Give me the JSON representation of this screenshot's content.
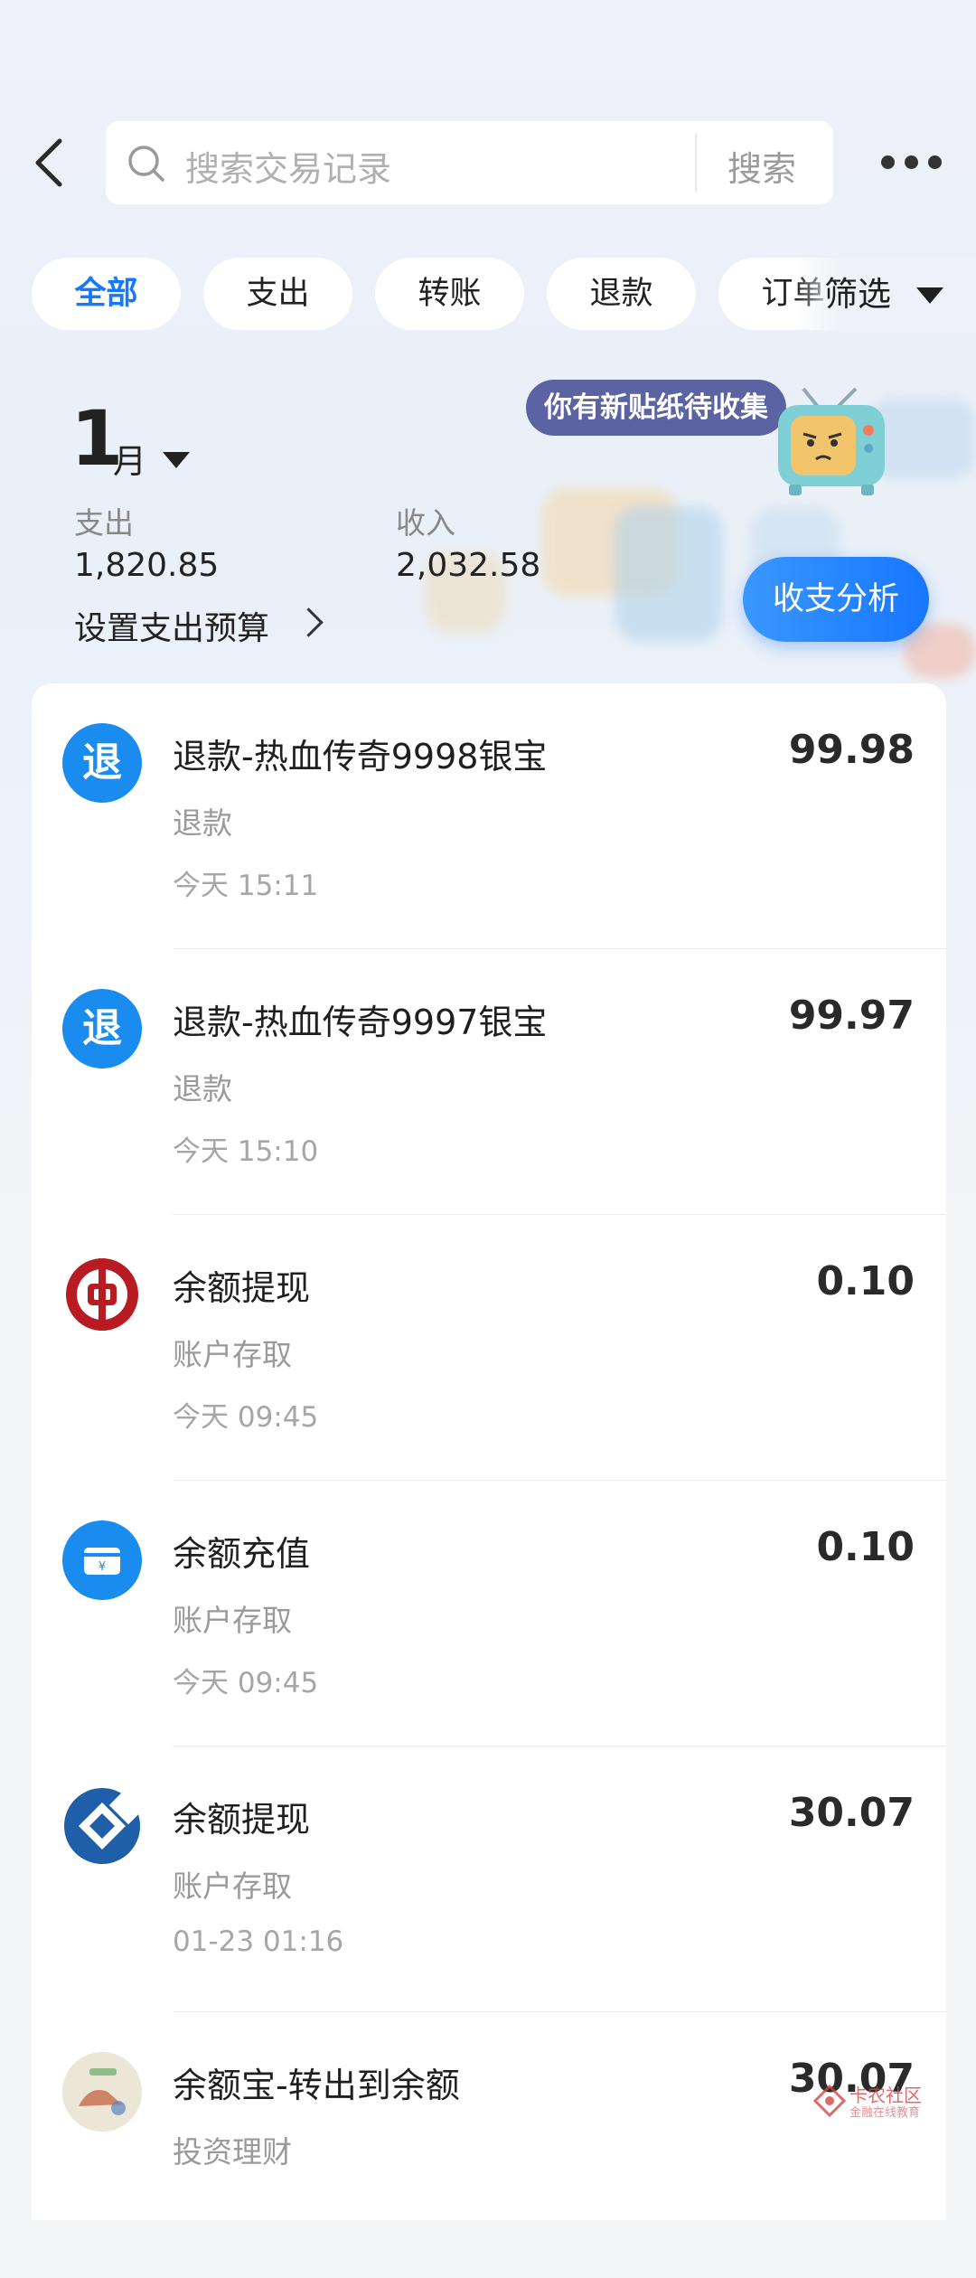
{
  "search": {
    "placeholder": "搜索交易记录",
    "button_label": "搜索"
  },
  "filters": {
    "chips": [
      {
        "label": "全部",
        "active": true
      },
      {
        "label": "支出",
        "active": false
      },
      {
        "label": "转账",
        "active": false
      },
      {
        "label": "退款",
        "active": false
      },
      {
        "label": "订单",
        "active": false
      }
    ],
    "filter_label": "筛选"
  },
  "summary": {
    "month_number": "1",
    "month_unit": "月",
    "expense_label": "支出",
    "expense_value": "1,820.85",
    "income_label": "收入",
    "income_value": "2,032.58",
    "budget_label": "设置支出预算",
    "sticker_tip": "你有新贴纸待收集",
    "analysis_button": "收支分析"
  },
  "transactions": [
    {
      "icon": "refund-icon",
      "icon_text": "退",
      "title": "退款-热血传奇9998银宝",
      "category": "退款",
      "time": "今天 15:11",
      "amount": "99.98"
    },
    {
      "icon": "refund-icon",
      "icon_text": "退",
      "title": "退款-热血传奇9997银宝",
      "category": "退款",
      "time": "今天 15:10",
      "amount": "99.97"
    },
    {
      "icon": "bank-of-china-icon",
      "title": "余额提现",
      "category": "账户存取",
      "time": "今天 09:45",
      "amount": "0.10"
    },
    {
      "icon": "balance-card-icon",
      "title": "余额充值",
      "category": "账户存取",
      "time": "今天 09:45",
      "amount": "0.10"
    },
    {
      "icon": "ccb-bank-icon",
      "title": "余额提现",
      "category": "账户存取",
      "time": "01-23 01:16",
      "amount": "30.07"
    },
    {
      "icon": "yuebao-avatar-icon",
      "title": "余额宝-转出到余额",
      "category": "投资理财",
      "time": "",
      "amount": "30.07"
    }
  ],
  "watermark": {
    "text": "卡农社区",
    "subtext": "金融在线教育"
  },
  "colors": {
    "accent": "#1677ff",
    "refund_icon_bg": "#1a8cf0",
    "boc_red": "#b81c22",
    "ccb_blue": "#1f5ea8",
    "sticker_tip_bg": "#5b63a3"
  }
}
